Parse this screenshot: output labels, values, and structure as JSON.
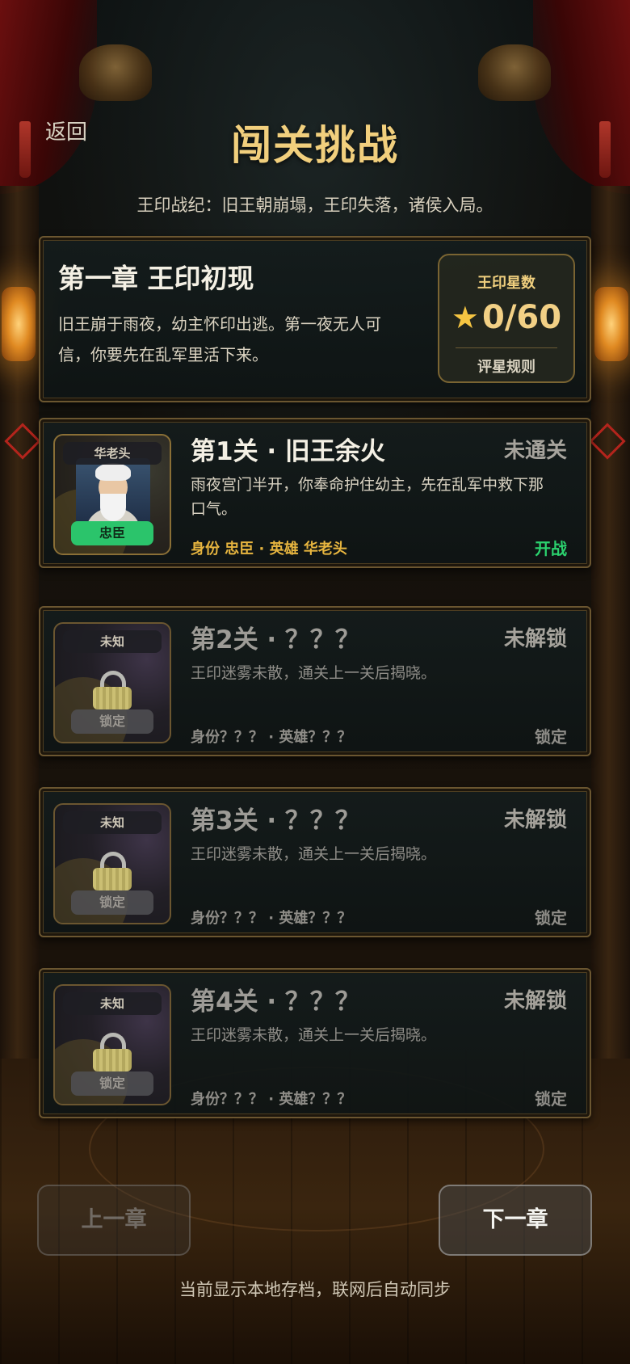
{
  "header": {
    "back_label": "返回",
    "title": "闯关挑战",
    "subtitle": "王印战纪：旧王朝崩塌，王印失落，诸侯入局。"
  },
  "chapter": {
    "title": "第一章 王印初现",
    "description": "旧王崩于雨夜，幼主怀印出逃。第一夜无人可信，你要先在乱军里活下来。",
    "stars": {
      "label": "王印星数",
      "value": "0/60",
      "earned": 0,
      "total": 60,
      "rule_label": "评星规则"
    }
  },
  "levels": [
    {
      "title": "第1关 · 旧王余火",
      "status": "未通关",
      "description": "雨夜宫门半开，你奉命护住幼主，先在乱军中救下那口气。",
      "meta": "身份 忠臣 · 英雄 华老头",
      "action": "开战",
      "card_name": "华老头",
      "card_role": "忠臣",
      "locked": false
    },
    {
      "title": "第2关 · ？？？",
      "status": "未解锁",
      "description": "王印迷雾未散，通关上一关后揭晓。",
      "meta": "身份？？？ · 英雄？？？",
      "action": "锁定",
      "card_name": "未知",
      "card_role": "锁定",
      "locked": true
    },
    {
      "title": "第3关 · ？？？",
      "status": "未解锁",
      "description": "王印迷雾未散，通关上一关后揭晓。",
      "meta": "身份？？？ · 英雄？？？",
      "action": "锁定",
      "card_name": "未知",
      "card_role": "锁定",
      "locked": true
    },
    {
      "title": "第4关 · ？？？",
      "status": "未解锁",
      "description": "王印迷雾未散，通关上一关后揭晓。",
      "meta": "身份？？？ · 英雄？？？",
      "action": "锁定",
      "card_name": "未知",
      "card_role": "锁定",
      "locked": true
    }
  ],
  "footer": {
    "prev_label": "上一章",
    "prev_enabled": false,
    "next_label": "下一章",
    "next_enabled": true,
    "sync_note": "当前显示本地存档，联网后自动同步"
  },
  "colors": {
    "title_gold": "#f1cf7d",
    "start_green": "#2bd26e",
    "meta_gold": "#e7b53f",
    "panel_border": "#6b5630"
  },
  "icons": {
    "star": "star-icon",
    "lock": "lock-icon"
  }
}
